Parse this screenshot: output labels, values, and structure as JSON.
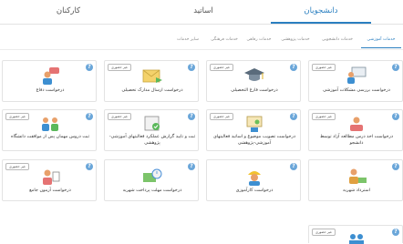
{
  "main_tabs": {
    "students": "دانشجویان",
    "professors": "اساتید",
    "staff": "کارکنان"
  },
  "sub_tabs": [
    "خدمات آموزشی",
    "خدمات دانشجویی",
    "خدمات پژوهشی",
    "خدمات رفاهی",
    "خدمات فرهنگی",
    "سایر خدمات"
  ],
  "badge_label": "غیر حضوری",
  "help_symbol": "?",
  "cards": [
    {
      "title": "درخواست بررسی مشکلات آموزشی"
    },
    {
      "title": "درخواست فارغ التحصیلی"
    },
    {
      "title": "درخواست ارسال مدارک تحصیلی"
    },
    {
      "title": "درخواست دفاع"
    },
    {
      "title": "درخواست اخذ درس مطالعه آزاد توسط دانشجو"
    },
    {
      "title": "درخواست تصویب موضوع و اساتید فعالیتهای آموزشی-پژوهشی"
    },
    {
      "title": "ثبت و تایید گزارش عملکرد فعالیتهای آموزشی-پژوهشی"
    },
    {
      "title": "ثبت دروس مهمان پس از موافقت دانشگاه"
    },
    {
      "title": "استرداد شهریه"
    },
    {
      "title": "درخواست کارآموزی"
    },
    {
      "title": "درخواست مهلت پرداخت شهریه"
    },
    {
      "title": "درخواست آزمون جامع"
    }
  ],
  "icons": [
    "person-board-icon",
    "graduation-cap-icon",
    "envelope-arrow-icon",
    "speaker-person-icon",
    "reader-icon",
    "certificate-person-icon",
    "certificate-check-icon",
    "group-people-icon",
    "money-person-icon",
    "worker-helmet-icon",
    "money-time-icon",
    "exam-person-icon"
  ],
  "colors": {
    "accent": "#2a7fc0",
    "help": "#6aa6d9"
  }
}
